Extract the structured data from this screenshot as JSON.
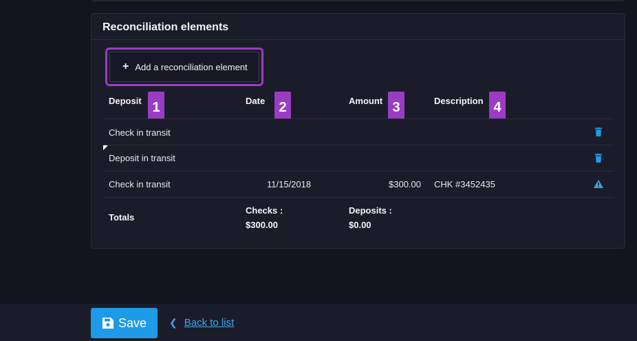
{
  "card": {
    "title": "Reconciliation elements",
    "add_button_label": "Add a reconciliation element"
  },
  "columns": [
    {
      "label": "Deposit",
      "badge": "1"
    },
    {
      "label": "Date",
      "badge": "2"
    },
    {
      "label": "Amount",
      "badge": "3"
    },
    {
      "label": "Description",
      "badge": "4"
    }
  ],
  "rows": [
    {
      "type": "Check in transit",
      "date": "",
      "amount": "",
      "description": "",
      "action": "trash-icon"
    },
    {
      "type": "Deposit in transit",
      "date": "",
      "amount": "",
      "description": "",
      "action": "trash-icon"
    },
    {
      "type": "Check in transit",
      "date": "11/15/2018",
      "amount": "$300.00",
      "description": "CHK #3452435",
      "action": "warning-icon"
    }
  ],
  "totals": {
    "label": "Totals",
    "checks_label": "Checks :",
    "checks_value": "$300.00",
    "deposits_label": "Deposits :",
    "deposits_value": "$0.00"
  },
  "footer": {
    "save_label": "Save",
    "back_label": "Back to list"
  },
  "colors": {
    "background": "#121420",
    "card": "#1a1d29",
    "accent": "#1e9be8",
    "highlight": "#9b3cc4"
  }
}
